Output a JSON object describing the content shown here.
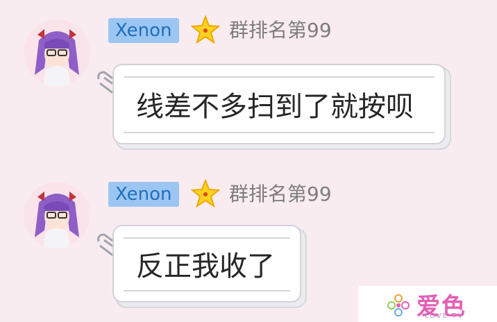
{
  "messages": [
    {
      "sender": "Xenon",
      "rank": "群排名第99",
      "text": "线差不多扫到了就按呗"
    },
    {
      "sender": "Xenon",
      "rank": "群排名第99",
      "text": "反正我收了"
    }
  ],
  "watermark": {
    "logo_text": "爱色",
    "sub_text": "LOVE TV"
  },
  "colors": {
    "background": "#f9ecf1",
    "name_tag_bg": "#9cc6f2",
    "name_tag_text": "#1f6fbf",
    "rank_text": "#7d7d7d",
    "watermark_pink": "#e35fb5"
  },
  "icons": {
    "star": "star-icon",
    "clip": "paperclip-icon",
    "watermark": "flower-logo-icon"
  }
}
